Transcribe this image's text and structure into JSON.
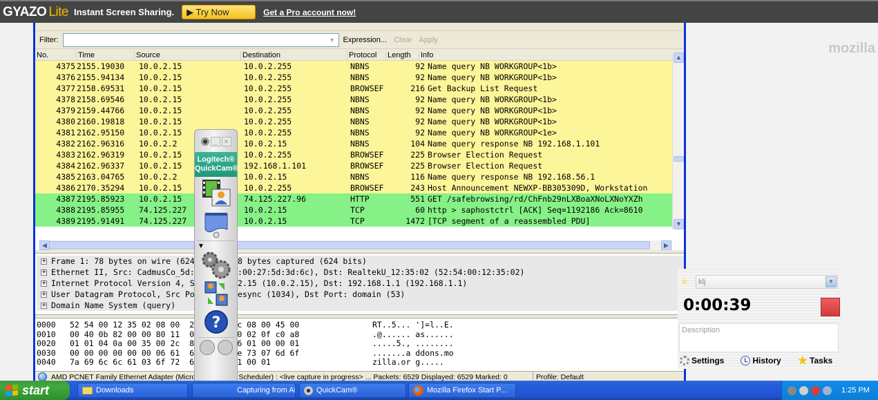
{
  "gyazo": {
    "logo": "GYAZO",
    "logo_suffix": "Lite",
    "tagline": "Instant Screen Sharing.",
    "try_now": "▶ Try Now",
    "pro_link": "Get a Pro account now!"
  },
  "background": {
    "watermark": "mozilla"
  },
  "wireshark": {
    "filter": {
      "label": "Filter:",
      "value": "",
      "expression_button": "Expression...",
      "clear_button": "Clear",
      "apply_button": "Apply"
    },
    "columns": [
      "No.",
      "Time",
      "Source",
      "Destination",
      "Protocol",
      "Length",
      "Info"
    ],
    "packets": [
      {
        "no": "4375",
        "time": "2155.19030",
        "src": "10.0.2.15",
        "dst": "10.0.2.255",
        "proto": "NBNS",
        "len": "92",
        "info": "Name query NB WORKGROUP<1b>",
        "color": "yellow"
      },
      {
        "no": "4376",
        "time": "2155.94134",
        "src": "10.0.2.15",
        "dst": "10.0.2.255",
        "proto": "NBNS",
        "len": "92",
        "info": "Name query NB WORKGROUP<1b>",
        "color": "yellow"
      },
      {
        "no": "4377",
        "time": "2158.69531",
        "src": "10.0.2.15",
        "dst": "10.0.2.255",
        "proto": "BROWSEF",
        "len": "216",
        "info": "Get Backup List Request",
        "color": "yellow"
      },
      {
        "no": "4378",
        "time": "2158.69546",
        "src": "10.0.2.15",
        "dst": "10.0.2.255",
        "proto": "NBNS",
        "len": "92",
        "info": "Name query NB WORKGROUP<1b>",
        "color": "yellow"
      },
      {
        "no": "4379",
        "time": "2159.44766",
        "src": "10.0.2.15",
        "dst": "10.0.2.255",
        "proto": "NBNS",
        "len": "92",
        "info": "Name query NB WORKGROUP<1b>",
        "color": "yellow"
      },
      {
        "no": "4380",
        "time": "2160.19818",
        "src": "10.0.2.15",
        "dst": "10.0.2.255",
        "proto": "NBNS",
        "len": "92",
        "info": "Name query NB WORKGROUP<1b>",
        "color": "yellow"
      },
      {
        "no": "4381",
        "time": "2162.95150",
        "src": "10.0.2.15",
        "dst": "10.0.2.255",
        "proto": "NBNS",
        "len": "92",
        "info": "Name query NB WORKGROUP<1e>",
        "color": "yellow"
      },
      {
        "no": "4382",
        "time": "2162.96316",
        "src": "10.0.2.2",
        "dst": "10.0.2.15",
        "proto": "NBNS",
        "len": "104",
        "info": "Name query response NB 192.168.1.101",
        "color": "yellow"
      },
      {
        "no": "4383",
        "time": "2162.96319",
        "src": "10.0.2.15",
        "dst": "10.0.2.255",
        "proto": "BROWSEF",
        "len": "225",
        "info": "Browser Election Request",
        "color": "yellow"
      },
      {
        "no": "4384",
        "time": "2162.96337",
        "src": "10.0.2.15",
        "dst": "192.168.1.101",
        "proto": "BROWSEF",
        "len": "225",
        "info": "Browser Election Request",
        "color": "yellow"
      },
      {
        "no": "4385",
        "time": "2163.04765",
        "src": "10.0.2.2",
        "dst": "10.0.2.15",
        "proto": "NBNS",
        "len": "116",
        "info": "Name query response NB 192.168.56.1",
        "color": "yellow"
      },
      {
        "no": "4386",
        "time": "2170.35294",
        "src": "10.0.2.15",
        "dst": "10.0.2.255",
        "proto": "BROWSEF",
        "len": "243",
        "info": "Host Announcement NEWXP-BB305309D, Workstation",
        "color": "yellow"
      },
      {
        "no": "4387",
        "time": "2195.85923",
        "src": "10.0.2.15",
        "dst": "74.125.227.96",
        "proto": "HTTP",
        "len": "551",
        "info": "GET /safebrowsing/rd/ChFnb29nLXBoaXNoLXNoYXZh",
        "color": "green"
      },
      {
        "no": "4388",
        "time": "2195.85955",
        "src": "74.125.227",
        "dst": "10.0.2.15",
        "proto": "TCP",
        "len": "60",
        "info": "http > saphostctrl [ACK] Seq=1192186 Ack=8610",
        "color": "green"
      },
      {
        "no": "4389",
        "time": "2195.91491",
        "src": "74.125.227",
        "dst": "10.0.2.15",
        "proto": "TCP",
        "len": "1472",
        "info": "[TCP segment of a reassembled PDU]",
        "color": "green"
      }
    ],
    "details": [
      "Frame 1: 78 bytes on wire (624 bits), 78 bytes captured (624 bits)",
      "Ethernet II, Src: CadmusCo_5d:3d:6c (08:00:27:5d:3d:6c), Dst: RealtekU_12:35:02 (52:54:00:12:35:02)",
      "Internet Protocol Version 4, Src: 10.0.2.15 (10.0.2.15), Dst: 192.168.1.1 (192.168.1.1)",
      "User Datagram Protocol, Src Port: activesync (1034), Dst Port: domain (53)",
      "Domain Name System (query)"
    ],
    "hex": [
      {
        "offset": "0000",
        "bytes": "52 54 00 12 35 02 08 00  27 5d 3d 6c 08 00 45 00",
        "ascii": "RT..5... ']=l..E."
      },
      {
        "offset": "0010",
        "bytes": "00 40 0b 82 00 00 80 11  00 00 0a 00 02 0f c0 a8",
        "ascii": ".@...... as......"
      },
      {
        "offset": "0020",
        "bytes": "01 01 04 0a 00 35 00 2c  8c b6 8c b6 01 00 00 01",
        "ascii": ".....5., ........"
      },
      {
        "offset": "0030",
        "bytes": "00 00 00 00 00 00 06 61  64 64 6f 6e 73 07 6d 6f",
        "ascii": ".......a ddons.mo"
      },
      {
        "offset": "0040",
        "bytes": "7a 69 6c 6c 61 03 6f 72  67 00 00 01 00 01",
        "ascii": "zilla.or g....."
      }
    ],
    "status": {
      "adapter": "AMD PCNET Family Ethernet Adapter (Microsoft's Packet Scheduler) : <live capture in progress> ... Packets: 6529 Displayed: 6529 Marked: 0",
      "profile": "Profile: Default"
    }
  },
  "quickcam": {
    "brand_line1": "Logitech®",
    "brand_line2": "QuickCam®"
  },
  "time_tracker": {
    "project": "klj",
    "elapsed": "0:00:39",
    "description_placeholder": "Description",
    "settings": "Settings",
    "history": "History",
    "tasks": "Tasks"
  },
  "taskbar": {
    "start": "start",
    "items": [
      {
        "label": "Downloads"
      },
      {
        "label": "Capturing from AMD ..."
      },
      {
        "label": "QuickCam®"
      },
      {
        "label": "Mozilla Firefox Start P..."
      }
    ],
    "clock": "1:25 PM"
  }
}
